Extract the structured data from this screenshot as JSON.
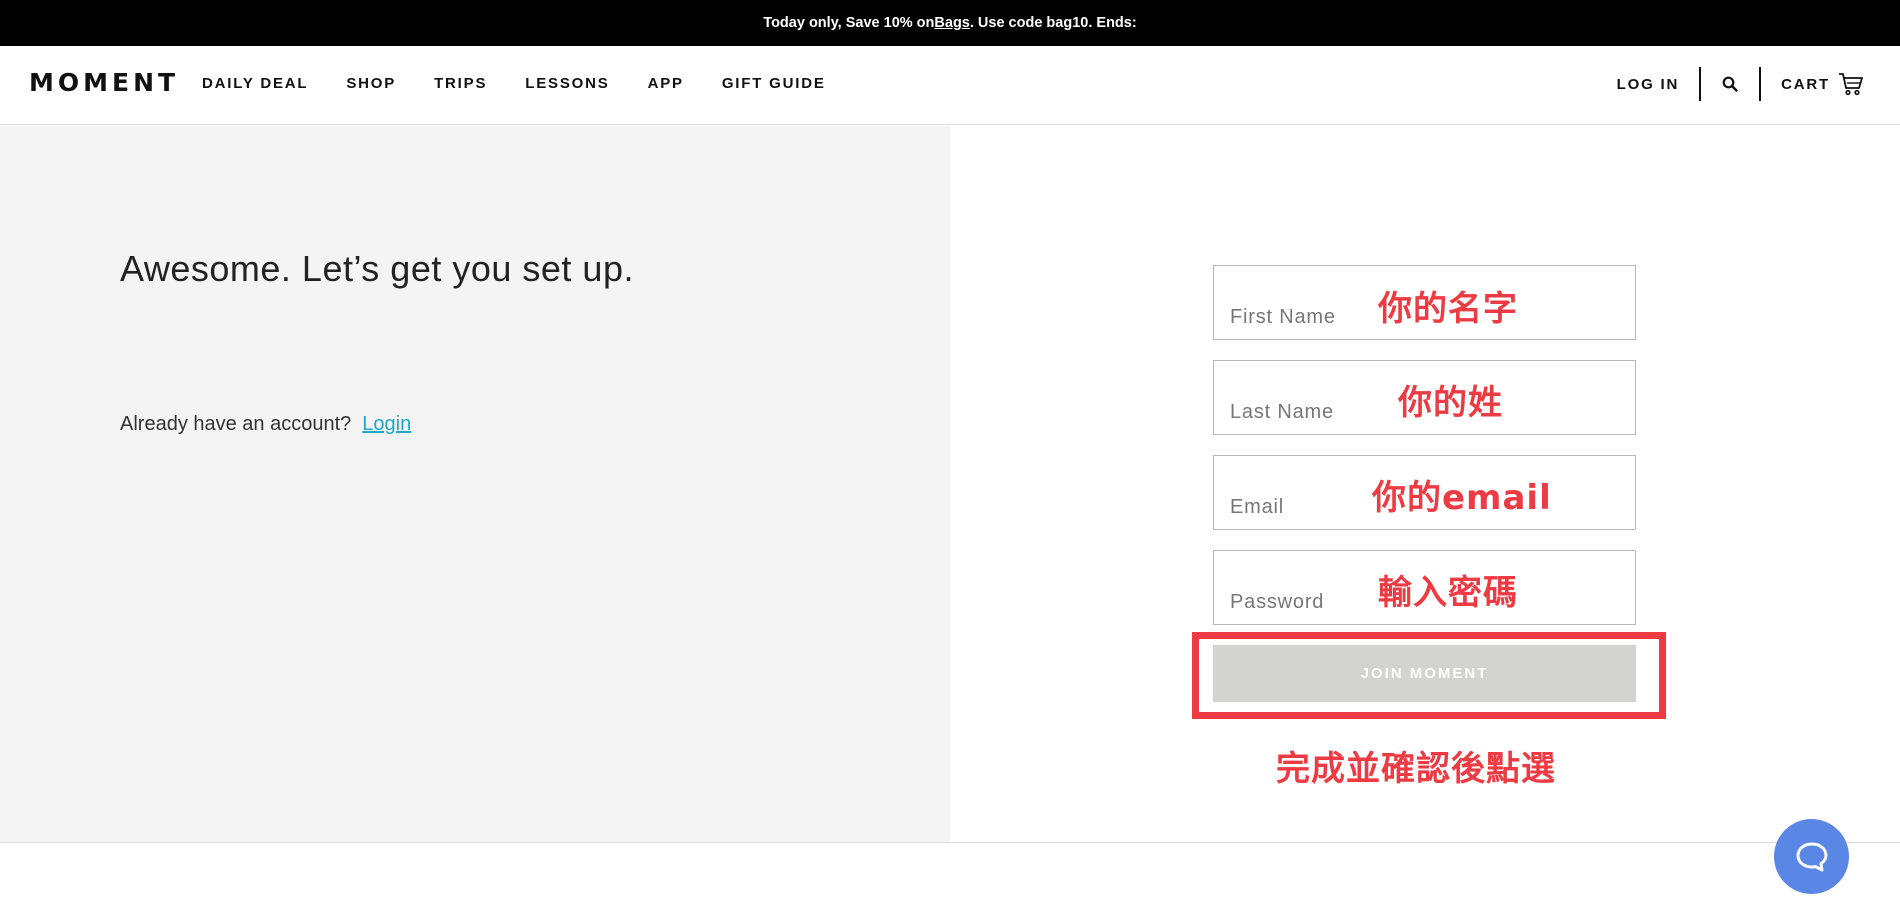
{
  "promo": {
    "prefix": "Today only, Save 10% on ",
    "link": "Bags",
    "suffix": ". Use code bag10. Ends:"
  },
  "header": {
    "logo": "MOMENT",
    "nav": [
      "DAILY DEAL",
      "SHOP",
      "TRIPS",
      "LESSONS",
      "APP",
      "GIFT GUIDE"
    ],
    "login": "LOG IN",
    "cart": "CART",
    "icons": {
      "search": "search-icon",
      "cart": "cart-icon"
    }
  },
  "left": {
    "headline": "Awesome. Let’s get you set up.",
    "account_question": "Already have an account?",
    "login_link": "Login"
  },
  "form": {
    "first_name": {
      "placeholder": "First Name",
      "value": "",
      "annotation": "你的名字"
    },
    "last_name": {
      "placeholder": "Last Name",
      "value": "",
      "annotation": "你的姓"
    },
    "email": {
      "placeholder": "Email",
      "value": "",
      "annotation": "你的email"
    },
    "password": {
      "placeholder": "Password",
      "value": "",
      "annotation": "輸入密碼"
    },
    "submit_label": "JOIN MOMENT",
    "submit_annotation": "完成並確認後點選"
  },
  "chat": {
    "icon": "chat-bubble-icon"
  },
  "colors": {
    "accent_link": "#20a7c9",
    "annotation_red": "#ee3a42",
    "button_disabled": "#d3d3d1",
    "chat_blue": "#5a86e6",
    "left_panel_bg": "#f4f4f4"
  }
}
